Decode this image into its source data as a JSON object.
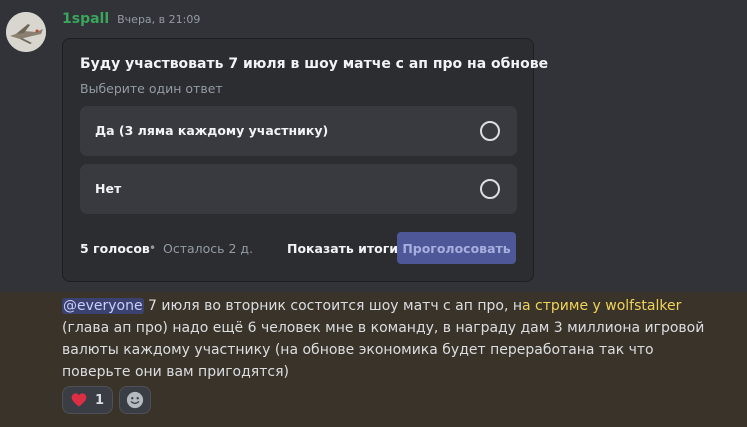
{
  "message": {
    "username": "1spall",
    "timestamp": "Вчера, в 21:09",
    "avatar_icon": "avatar-image"
  },
  "poll": {
    "question": "Буду участвовать 7 июля в шоу матче с ап про на обнове",
    "hint": "Выберите один ответ",
    "options": [
      {
        "label": "Да (3 ляма каждому участнику)"
      },
      {
        "label": "Нет"
      }
    ],
    "votes": "5 голосов",
    "separator": "•",
    "remaining": "Осталось 2 д.",
    "show_results": "Показать итоги",
    "vote_button": "Проголосовать"
  },
  "text": {
    "mention": "@everyone",
    "part1": " 7 июля во вторник состоится шоу матч с ап про, н",
    "link": "а стриме у wolfstalker",
    "part2": " (глава ап про) надо ещё 6 человек мне в команду, в награду дам 3 миллиона игровой валюты каждому участнику  (на обнове экономика будет переработана так что поверьте они вам пригодятся)"
  },
  "reactions": [
    {
      "icon": "red-heart-icon",
      "count": "1"
    }
  ],
  "add_reaction_icon": "smiley-add-reaction-icon",
  "colors": {
    "background": "#313338",
    "username": "#3ba55d",
    "highlight": "#3a3329",
    "vote_button": "#4e5797",
    "mention_bg": "#3c4270",
    "link": "#f0d45a"
  }
}
